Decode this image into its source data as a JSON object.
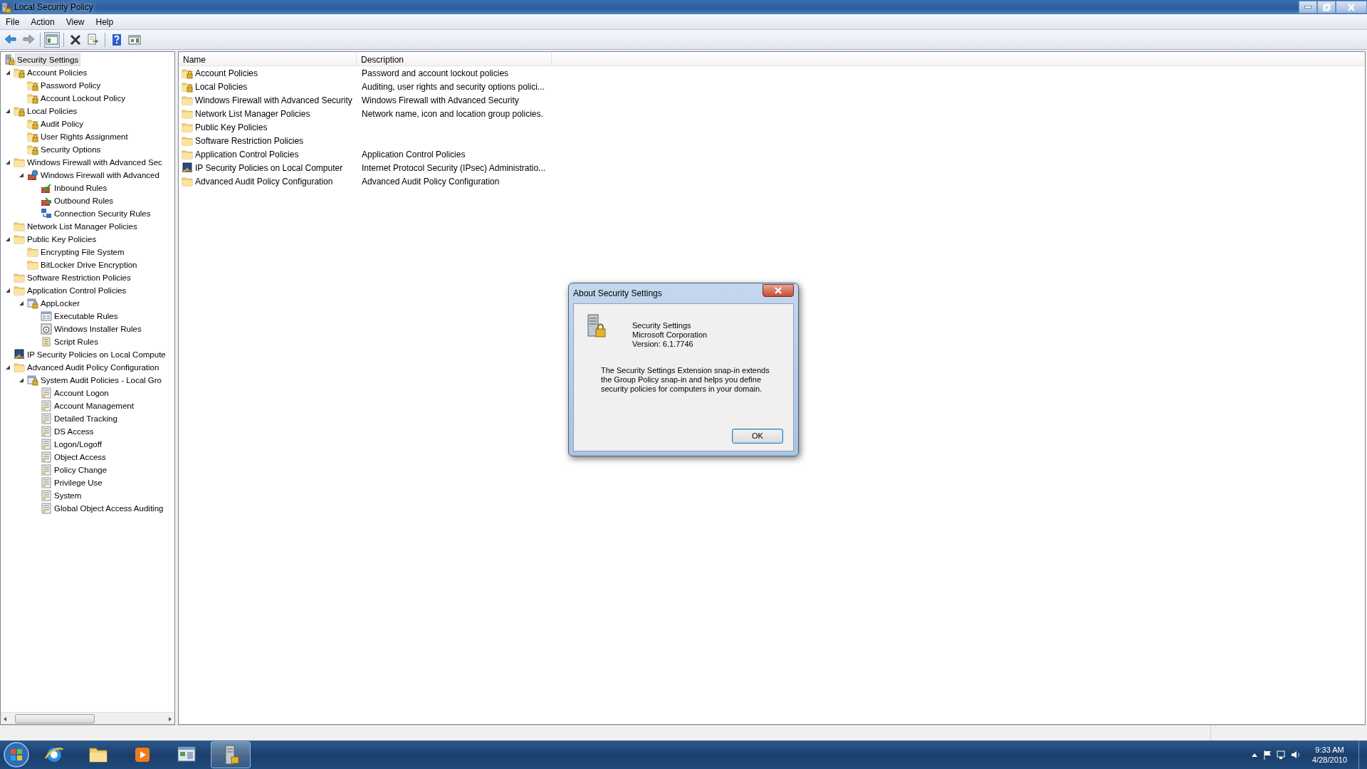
{
  "window": {
    "title": "Local Security Policy"
  },
  "menu": [
    "File",
    "Action",
    "View",
    "Help"
  ],
  "tree": {
    "label": "Security Settings",
    "kind": "root",
    "selected": true,
    "children": [
      {
        "label": "Account Policies",
        "kind": "lockfolder",
        "selected": false,
        "expanded": true,
        "children": [
          {
            "label": "Password Policy",
            "kind": "lockfolder",
            "selected": false
          },
          {
            "label": "Account Lockout Policy",
            "kind": "lockfolder",
            "selected": false
          }
        ]
      },
      {
        "label": "Local Policies",
        "kind": "lockfolder",
        "selected": false,
        "expanded": true,
        "children": [
          {
            "label": "Audit Policy",
            "kind": "lockfolder",
            "selected": false
          },
          {
            "label": "User Rights Assignment",
            "kind": "lockfolder",
            "selected": false
          },
          {
            "label": "Security Options",
            "kind": "lockfolder",
            "selected": false
          }
        ]
      },
      {
        "label": "Windows Firewall with Advanced Sec",
        "kind": "folder",
        "selected": false,
        "expanded": true,
        "children": [
          {
            "label": "Windows Firewall with Advanced",
            "kind": "firewall",
            "selected": false,
            "expanded": true,
            "children": [
              {
                "label": "Inbound Rules",
                "kind": "inbound",
                "selected": false
              },
              {
                "label": "Outbound Rules",
                "kind": "outbound",
                "selected": false
              },
              {
                "label": "Connection Security Rules",
                "kind": "connection",
                "selected": false
              }
            ]
          }
        ]
      },
      {
        "label": "Network List Manager Policies",
        "kind": "folder",
        "selected": false
      },
      {
        "label": "Public Key Policies",
        "kind": "folder",
        "selected": false,
        "expanded": true,
        "children": [
          {
            "label": "Encrypting File System",
            "kind": "folder",
            "selected": false
          },
          {
            "label": "BitLocker Drive Encryption",
            "kind": "folder",
            "selected": false
          }
        ]
      },
      {
        "label": "Software Restriction Policies",
        "kind": "folder",
        "selected": false
      },
      {
        "label": "Application Control Policies",
        "kind": "folder",
        "selected": false,
        "expanded": true,
        "children": [
          {
            "label": "AppLocker",
            "kind": "applocker",
            "selected": false,
            "expanded": true,
            "children": [
              {
                "label": "Executable Rules",
                "kind": "exe",
                "selected": false
              },
              {
                "label": "Windows Installer Rules",
                "kind": "installer",
                "selected": false
              },
              {
                "label": "Script Rules",
                "kind": "script",
                "selected": false
              }
            ]
          }
        ]
      },
      {
        "label": "IP Security Policies on Local Compute",
        "kind": "ipsec",
        "selected": false
      },
      {
        "label": "Advanced Audit Policy Configuration",
        "kind": "folder",
        "selected": false,
        "expanded": true,
        "children": [
          {
            "label": "System Audit Policies - Local Gro",
            "kind": "applocker",
            "selected": false,
            "expanded": true,
            "children": [
              {
                "label": "Account Logon",
                "kind": "audit",
                "selected": false
              },
              {
                "label": "Account Management",
                "kind": "audit",
                "selected": false
              },
              {
                "label": "Detailed Tracking",
                "kind": "audit",
                "selected": false
              },
              {
                "label": "DS Access",
                "kind": "audit",
                "selected": false
              },
              {
                "label": "Logon/Logoff",
                "kind": "audit",
                "selected": false
              },
              {
                "label": "Object Access",
                "kind": "audit",
                "selected": false
              },
              {
                "label": "Policy Change",
                "kind": "audit",
                "selected": false
              },
              {
                "label": "Privilege Use",
                "kind": "audit",
                "selected": false
              },
              {
                "label": "System",
                "kind": "audit",
                "selected": false
              },
              {
                "label": "Global Object Access Auditing",
                "kind": "audit",
                "selected": false
              }
            ]
          }
        ]
      }
    ]
  },
  "list": {
    "columns": [
      "Name",
      "Description"
    ],
    "rows": [
      {
        "name": "Account Policies",
        "description": "Password and account lockout policies",
        "kind": "lockfolder"
      },
      {
        "name": "Local Policies",
        "description": "Auditing, user rights and security options polici...",
        "kind": "lockfolder"
      },
      {
        "name": "Windows Firewall with Advanced Security",
        "description": "Windows Firewall with Advanced Security",
        "kind": "folder"
      },
      {
        "name": "Network List Manager Policies",
        "description": "Network name, icon and location group policies.",
        "kind": "folder"
      },
      {
        "name": "Public Key Policies",
        "kind": "folder"
      },
      {
        "name": "Software Restriction Policies",
        "kind": "folder"
      },
      {
        "name": "Application Control Policies",
        "description": "Application Control Policies",
        "kind": "folder"
      },
      {
        "name": "IP Security Policies on Local Computer",
        "description": "Internet Protocol Security (IPsec) Administratio...",
        "kind": "ipsec"
      },
      {
        "name": "Advanced Audit Policy Configuration",
        "description": "Advanced Audit Policy Configuration",
        "kind": "folder"
      }
    ]
  },
  "dialog": {
    "title": "About Security Settings",
    "product": "Security Settings",
    "company": "Microsoft Corporation",
    "version": "Version: 6.1.7746",
    "text": "The Security Settings Extension snap-in extends the Group Policy snap-in and helps you define security policies for computers in your domain.",
    "button": "OK"
  },
  "taskbar": {
    "buttons": [
      {
        "kind": "ie",
        "selected": false
      },
      {
        "kind": "explorer",
        "selected": false
      },
      {
        "kind": "media",
        "selected": false
      },
      {
        "kind": "console",
        "selected": false
      },
      {
        "kind": "policy",
        "selected": true
      }
    ],
    "time": "9:33 AM",
    "date": "4/28/2010"
  }
}
